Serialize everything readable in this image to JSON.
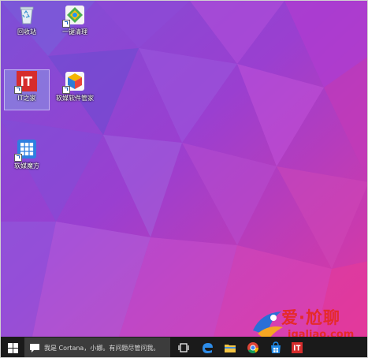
{
  "desktop": {
    "icons": [
      {
        "label": "回收站"
      },
      {
        "label": "一键清理"
      },
      {
        "label": "IT之家"
      },
      {
        "label": "软媒软件管家"
      },
      {
        "label": "软媒魔方"
      }
    ]
  },
  "taskbar": {
    "search_placeholder": "我是 Cortana，小娜。有问题尽管问我。",
    "icons": [
      "windows-logo-icon",
      "task-view-icon",
      "edge-browser-icon",
      "file-explorer-icon",
      "chrome-icon",
      "store-icon",
      "ithome-app-icon"
    ]
  },
  "watermark": {
    "line1": "爱·尬聊",
    "line2": "igaliao.com"
  },
  "colors": {
    "taskbar": "#1a1a1a",
    "wallpaper_top": "#8a45d4",
    "wallpaper_bottom": "#e23aa0",
    "ithome_red": "#d62c2c",
    "watermark_red": "#e52a2a"
  }
}
